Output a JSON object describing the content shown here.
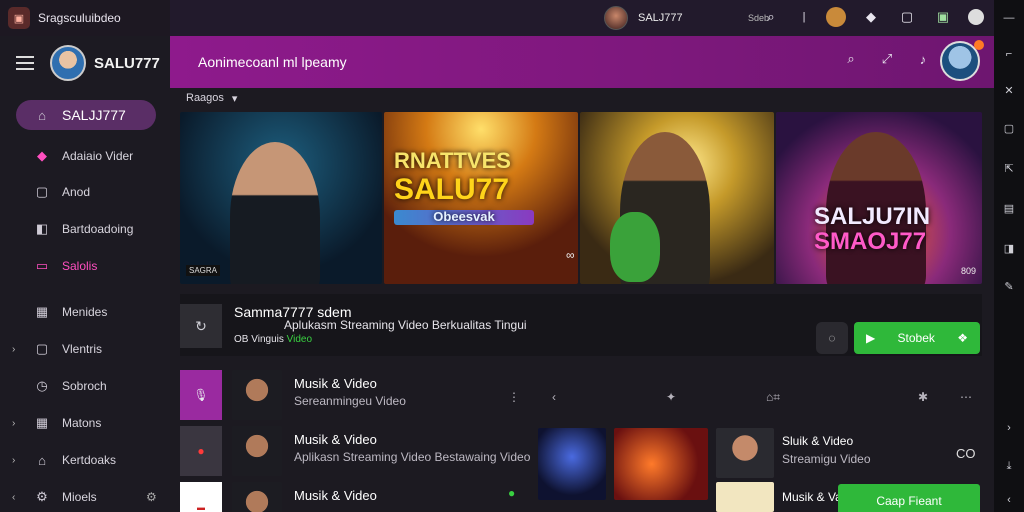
{
  "titlebar": {
    "app_title": "Sragsculuibdeo",
    "user": "SALJ777",
    "small_label": "Sdeb"
  },
  "sidebar": {
    "username": "SALU777",
    "items": [
      {
        "label": "SALJJ777",
        "icon": "home-icon"
      },
      {
        "label": "Adaiaio Vider",
        "icon": "diamond-icon"
      },
      {
        "label": "Anod",
        "icon": "square-icon"
      },
      {
        "label": "Bartdoadoing",
        "icon": "box-icon"
      },
      {
        "label": "Salolis",
        "icon": "chat-icon"
      },
      {
        "label": "Menides",
        "icon": "grid-icon"
      },
      {
        "label": "Vlentris",
        "icon": "square-icon"
      },
      {
        "label": "Sobroch",
        "icon": "clock-icon"
      },
      {
        "label": "Matons",
        "icon": "grid-icon"
      },
      {
        "label": "Kertdoaks",
        "icon": "tag-icon"
      },
      {
        "label": "Mioels",
        "icon": "gear-icon"
      }
    ]
  },
  "header": {
    "title": "Aonimecoanl ml lpeamy"
  },
  "main": {
    "section_label": "Raagos",
    "banner": {
      "b2_line1": "RNATTVES",
      "b2_line2": "SALU77",
      "b2_line3": "Obeesvak",
      "b4_line1": "SALJU7IN",
      "b4_line2": "SMAOJ77",
      "b1_tag": "SAGRA",
      "b4_tag": "809"
    },
    "info": {
      "title": "Samma7777 sdem",
      "subtitle": "Aplukasm Streaming Video Berkualitas Tingui",
      "meta_prefix": "OB",
      "meta_text": "Vinguis",
      "meta_green": "Video",
      "green_button": "Stobek"
    },
    "rows": [
      {
        "title": "Musik & Video",
        "subtitle": "Sereanmingeu Video"
      },
      {
        "title": "Musik & Video",
        "subtitle": "Aplikasn Streaming Video Bestawaing Video"
      },
      {
        "title": "Musik & Video",
        "subtitle": ""
      }
    ],
    "right_row": {
      "title": "Sluik & Video",
      "subtitle": "Streamigu Video",
      "badge": "CO"
    },
    "right_row3_title": "Musik & Va",
    "float_button": "Caap Fieant"
  },
  "colors": {
    "accent": "#8e1a8c",
    "sidebar_active": "#5a2e66",
    "green": "#2fb83a",
    "pink": "#ff4fc0"
  }
}
